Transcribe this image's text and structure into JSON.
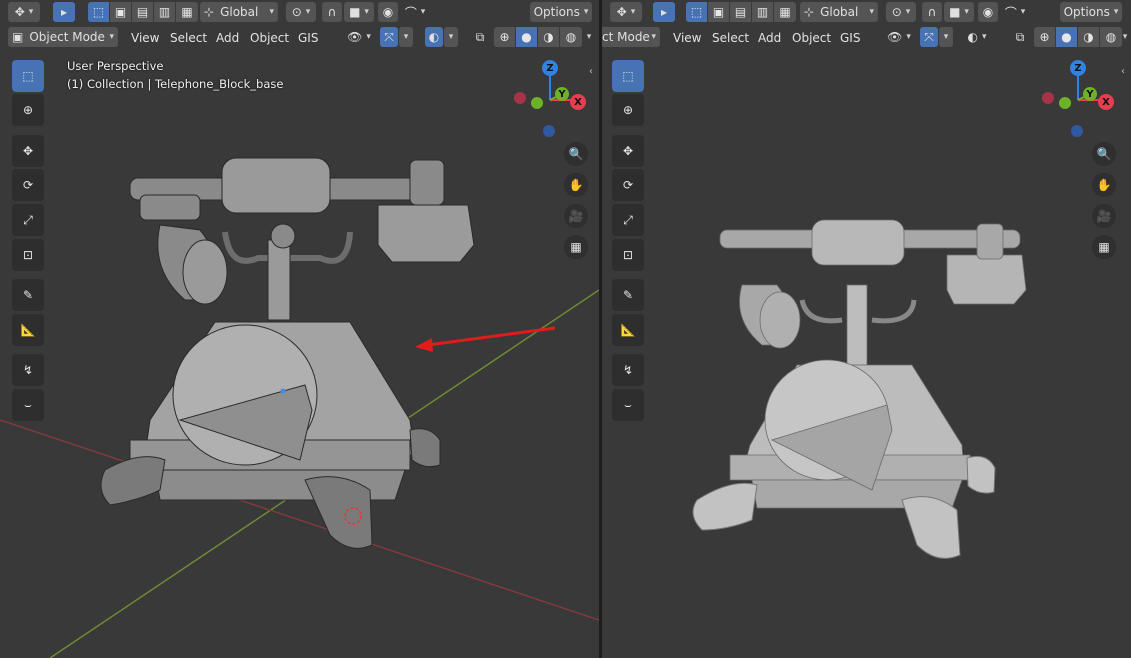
{
  "header": {
    "transform_orientation": "Global",
    "options_label": "Options",
    "mode_label": "Object Mode",
    "mode_label_right": "ct Mode",
    "menus": [
      "View",
      "Select",
      "Add",
      "Object",
      "GIS"
    ]
  },
  "overlay": {
    "view_name": "User Perspective",
    "collection_info": "(1) Collection | Telephone_Block_base"
  },
  "gizmo": {
    "z": "Z",
    "y": "Y",
    "x": "X"
  },
  "colors": {
    "accent": "#4772b3",
    "x_axis": "#e53f4f",
    "y_axis": "#6bb229",
    "z_axis": "#2f83e3",
    "annotation_arrow": "#e21b1b"
  },
  "icons": {
    "toolbar": [
      "select-box-icon",
      "cursor-icon",
      "move-icon",
      "rotate-icon",
      "scale-icon",
      "transform-icon",
      "annotate-icon",
      "measure-icon",
      "shear-icon",
      "bend-icon"
    ],
    "nav": [
      "zoom-icon",
      "pan-hand-icon",
      "camera-icon",
      "grid-ortho-icon"
    ]
  }
}
